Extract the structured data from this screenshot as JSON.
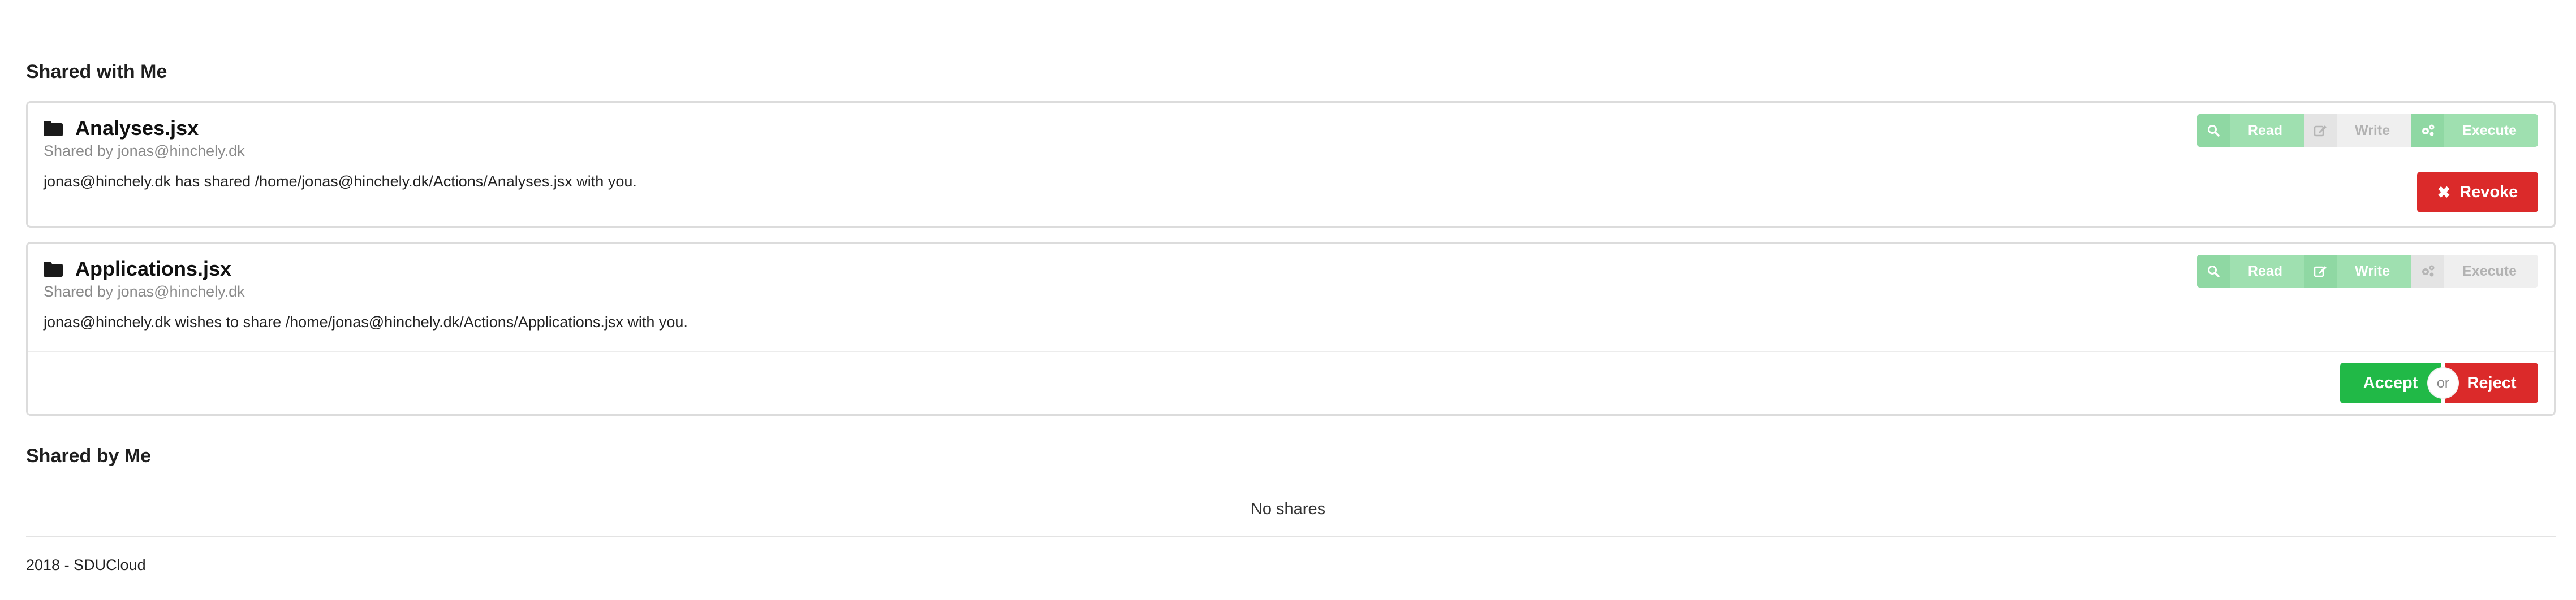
{
  "shared_with_me": {
    "title": "Shared with Me",
    "items": [
      {
        "file_name": "Analyses.jsx",
        "shared_by": "Shared by jonas@hinchely.dk",
        "description": "jonas@hinchely.dk has shared /home/jonas@hinchely.dk/Actions/Analyses.jsx with you.",
        "permissions": {
          "read_label": "Read",
          "write_label": "Write",
          "execute_label": "Execute",
          "read": true,
          "write": false,
          "execute": true
        },
        "action_label": "Revoke"
      },
      {
        "file_name": "Applications.jsx",
        "shared_by": "Shared by jonas@hinchely.dk",
        "description": "jonas@hinchely.dk wishes to share /home/jonas@hinchely.dk/Actions/Applications.jsx with you.",
        "permissions": {
          "read_label": "Read",
          "write_label": "Write",
          "execute_label": "Execute",
          "read": true,
          "write": true,
          "execute": false
        },
        "accept_label": "Accept",
        "or_label": "or",
        "reject_label": "Reject"
      }
    ]
  },
  "shared_by_me": {
    "title": "Shared by Me",
    "empty_text": "No shares"
  },
  "footer": {
    "text": "2018 - SDUCloud"
  },
  "icons": {
    "folder": "folder-icon",
    "read": "search-icon",
    "write": "edit-icon",
    "execute": "cogs-icon",
    "revoke": "close-icon"
  },
  "colors": {
    "permission_on": "#9fe0b0",
    "permission_off": "#efefef",
    "danger": "#db2a2a",
    "success": "#21b947"
  }
}
